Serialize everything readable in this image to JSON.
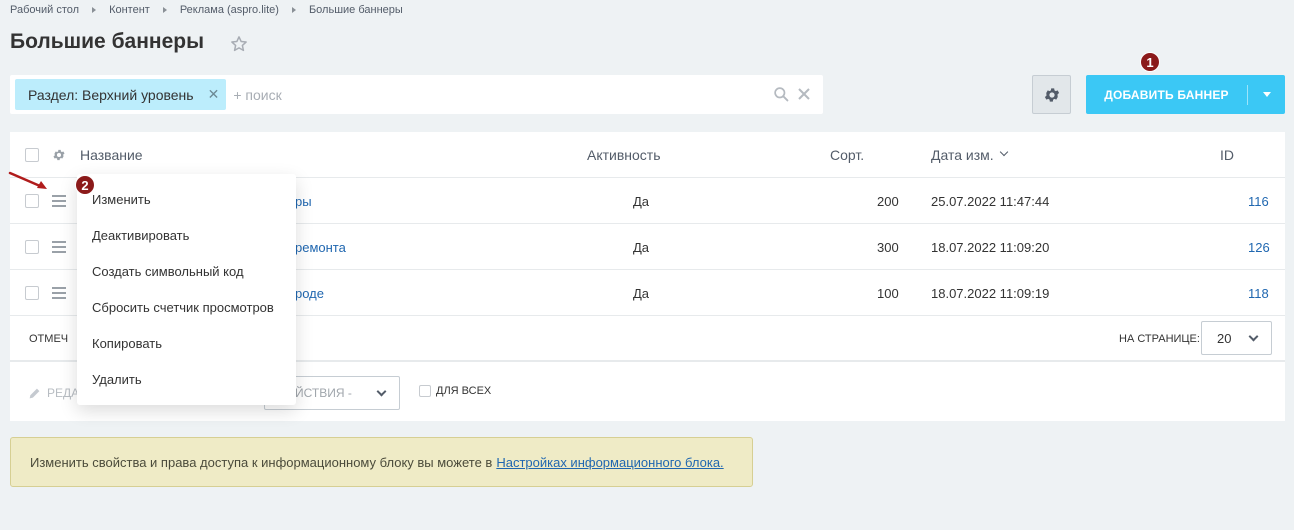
{
  "breadcrumb": [
    "Рабочий стол",
    "Контент",
    "Реклама (aspro.lite)",
    "Большие баннеры"
  ],
  "page": {
    "title": "Большие баннеры"
  },
  "filter": {
    "tag": "Раздел: Верхний уровень",
    "placeholder": "+ поиск"
  },
  "toolbar": {
    "add_label": "ДОБАВИТЬ БАННЕР"
  },
  "annotations": {
    "badge1": "1",
    "badge2": "2"
  },
  "colors": {
    "accent": "#3bc8f5",
    "link": "#2067b0",
    "badge": "#8b1a1a",
    "tag": "#bcedfc"
  },
  "grid": {
    "columns": {
      "name": "Название",
      "active": "Активность",
      "sort": "Сорт.",
      "date": "Дата изм.",
      "id": "ID"
    },
    "rows": [
      {
        "name_visible": "ры",
        "active": "Да",
        "sort": "200",
        "date": "25.07.2022 11:47:44",
        "id": "116"
      },
      {
        "name_visible": "ремонта",
        "active": "Да",
        "sort": "300",
        "date": "18.07.2022 11:09:20",
        "id": "126"
      },
      {
        "name_visible": "роде",
        "active": "Да",
        "sort": "100",
        "date": "18.07.2022 11:09:19",
        "id": "118"
      }
    ],
    "footer": {
      "marked_label": "ОТМЕЧ",
      "per_page_label": "НА СТРАНИЦЕ:",
      "per_page_value": "20"
    },
    "actions": {
      "edit_label": "РЕДА",
      "actions_select": "ЕЙСТВИЯ -",
      "for_all_label": "ДЛЯ ВСЕХ"
    }
  },
  "context_menu": {
    "items": [
      "Изменить",
      "Деактивировать",
      "Создать символьный код",
      "Сбросить счетчик просмотров",
      "Копировать",
      "Удалить"
    ]
  },
  "notice": {
    "text": "Изменить свойства и права доступа к информационному блоку вы можете в",
    "link": "Настройках информационного блока."
  }
}
